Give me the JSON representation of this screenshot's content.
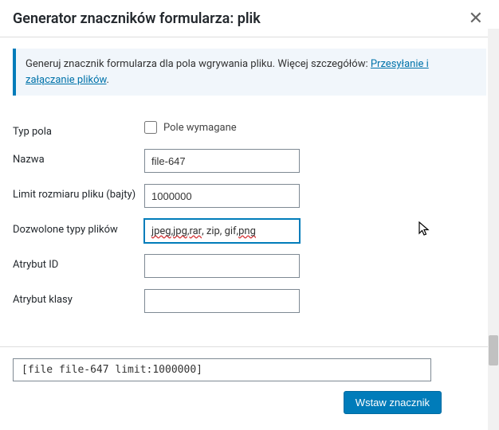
{
  "header": {
    "title": "Generator znaczników formularza: plik",
    "close": "✕"
  },
  "info": {
    "text_before": "Generuj znacznik formularza dla pola wgrywania pliku. Więcej szczegółów: ",
    "link": "Przesyłanie i załączanie plików",
    "text_after": "."
  },
  "form": {
    "field_type_label": "Typ pola",
    "required_label": "Pole wymagane",
    "name_label": "Nazwa",
    "name_value": "file-647",
    "size_limit_label": "Limit rozmiaru pliku (bajty)",
    "size_limit_value": "1000000",
    "allowed_types_label": "Dozwolone typy plików",
    "allowed_types_value": "jpeg, jpg, rar, zip, gif, png",
    "id_label": "Atrybut ID",
    "id_value": "",
    "class_label": "Atrybut klasy",
    "class_value": ""
  },
  "output": {
    "code": "[file file-647 limit:1000000]",
    "button": "Wstaw znacznik"
  }
}
